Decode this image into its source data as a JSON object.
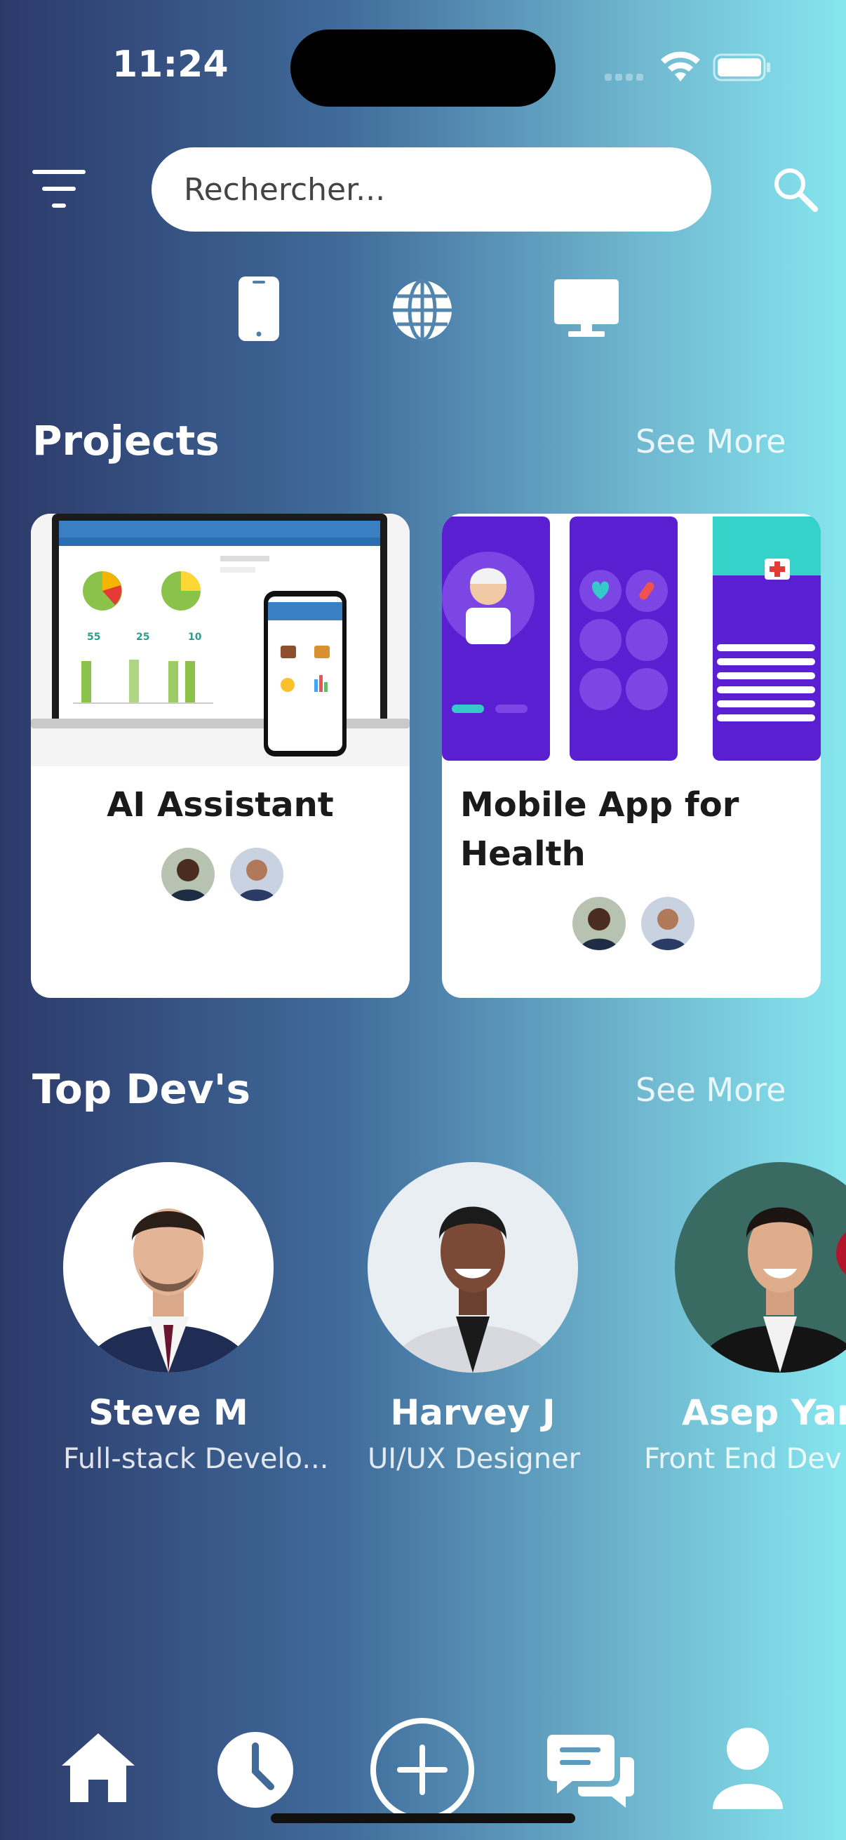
{
  "status_bar": {
    "time": "11:24"
  },
  "search": {
    "placeholder": "Rechercher..."
  },
  "projects": {
    "title": "Projects",
    "see_more": "See More",
    "items": [
      {
        "title": "AI Assistant"
      },
      {
        "title_line1": "Mobile App for",
        "title_line2": "Health"
      }
    ]
  },
  "devs": {
    "title": "Top Dev's",
    "see_more": "See More",
    "items": [
      {
        "name": "Steve M",
        "role": "Full-stack Develo..."
      },
      {
        "name": "Harvey J",
        "role": "UI/UX Designer"
      },
      {
        "name": "Asep Yant",
        "role": "Front End Dev"
      }
    ]
  },
  "icons": {
    "filter": "filter-icon",
    "search": "search-icon",
    "phone": "phone-icon",
    "globe": "globe-icon",
    "desktop": "desktop-icon",
    "home": "home-icon",
    "history": "clock-icon",
    "add": "add-icon",
    "chat": "chat-icon",
    "profile": "profile-icon"
  },
  "colors": {
    "accent_purple": "#5a1fd1",
    "teal": "#35c9c9",
    "gradient_left": "#2c3a6a",
    "gradient_right": "#86e6ee"
  }
}
